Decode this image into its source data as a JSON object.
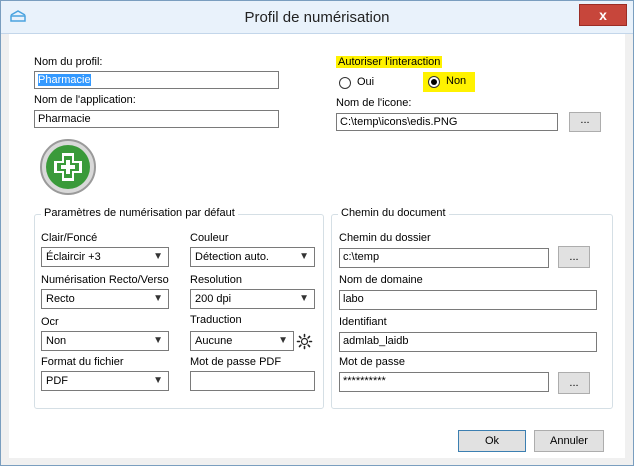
{
  "window": {
    "title": "Profil de numérisation",
    "close_label": "x"
  },
  "profile": {
    "name_label": "Nom du profil:",
    "name_value": "Pharmacie",
    "app_label": "Nom de l'application:",
    "app_value": "Pharmacie"
  },
  "interaction": {
    "label": "Autoriser l'interaction",
    "oui_label": "Oui",
    "non_label": "Non",
    "selected": "Non"
  },
  "icon": {
    "label": "Nom de l'icone:",
    "value": "C:\\temp\\icons\\edis.PNG",
    "browse_label": "..."
  },
  "scan_settings": {
    "title": "Paramètres de numérisation par défaut",
    "clair_label": "Clair/Foncé",
    "clair_value": "Éclaircir +3",
    "couleur_label": "Couleur",
    "couleur_value": "Détection auto.",
    "recto_label": "Numérisation Recto/Verso",
    "recto_value": "Recto",
    "resolution_label": "Resolution",
    "resolution_value": "200 dpi",
    "ocr_label": "Ocr",
    "ocr_value": "Non",
    "traduction_label": "Traduction",
    "traduction_value": "Aucune",
    "format_label": "Format du fichier",
    "format_value": "PDF",
    "pdf_password_label": "Mot de passe PDF",
    "pdf_password_value": ""
  },
  "document_path": {
    "title": "Chemin du document",
    "folder_label": "Chemin du dossier",
    "folder_value": "c:\\temp",
    "browse_label": "...",
    "domain_label": "Nom de domaine",
    "domain_value": "labo",
    "id_label": "Identifiant",
    "id_value": "admlab_laidb",
    "password_label": "Mot de passe",
    "password_value": "**********",
    "password_browse_label": "..."
  },
  "buttons": {
    "ok": "Ok",
    "cancel": "Annuler"
  },
  "colors": {
    "highlight": "#fff200",
    "selection": "#3399ff",
    "close": "#c7463b",
    "logo_green": "#3a9a3a"
  }
}
